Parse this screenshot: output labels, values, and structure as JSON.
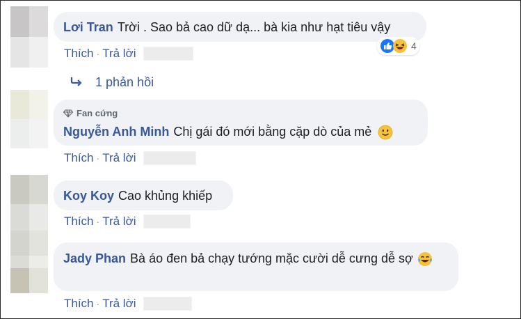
{
  "comments": [
    {
      "author": "Lơi Tran",
      "text": "Trời . Sao bả cao dữ dạ... bà kia như hạt tiêu vậy",
      "like_label": "Thích",
      "reply_label": "Trả lời",
      "reactions": {
        "icons": [
          "like-icon",
          "laughing-icon"
        ],
        "count": "4"
      },
      "replies_label": "1 phản hồi"
    },
    {
      "badge": "Fan cứng",
      "author": "Nguyễn Anh Minh",
      "text": "Chị gái đó mới bằng cặp dò của mẻ",
      "emoji": "smile-emoji",
      "like_label": "Thích",
      "reply_label": "Trả lời"
    },
    {
      "author": "Koy Koy",
      "text": "Cao khủng khiếp",
      "like_label": "Thích",
      "reply_label": "Trả lời"
    },
    {
      "author": "Jady Phan",
      "text": "Bà áo đen bả chạy tướng mặc cười dễ cưng dễ sợ",
      "emoji": "tears-of-joy-emoji",
      "like_label": "Thích",
      "reply_label": "Trả lời"
    }
  ],
  "colors": {
    "name": "#385898",
    "bubble": "#f0f2f5",
    "text": "#1c1e21"
  }
}
